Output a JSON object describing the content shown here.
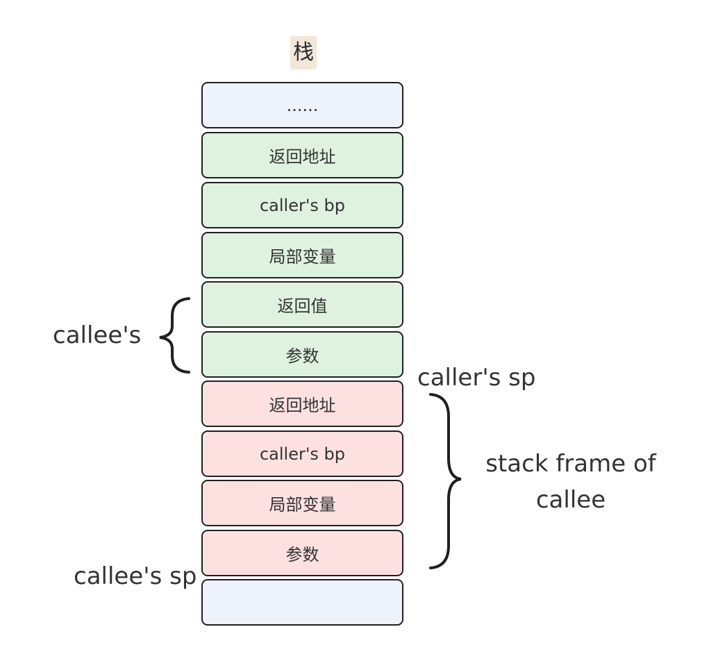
{
  "title": "栈",
  "cells": [
    {
      "text": "......",
      "fill": "neutral"
    },
    {
      "text": "返回地址",
      "fill": "green"
    },
    {
      "text": "caller's bp",
      "fill": "green"
    },
    {
      "text": "局部变量",
      "fill": "green"
    },
    {
      "text": "返回值",
      "fill": "green"
    },
    {
      "text": "参数",
      "fill": "green"
    },
    {
      "text": "返回地址",
      "fill": "red"
    },
    {
      "text": "caller's bp",
      "fill": "red"
    },
    {
      "text": "局部变量",
      "fill": "red"
    },
    {
      "text": "参数",
      "fill": "red"
    },
    {
      "text": "",
      "fill": "neutral"
    }
  ],
  "annotations": {
    "callee_args": "callee's",
    "caller_sp": "caller's sp",
    "callee_frame_line1": "stack frame of",
    "callee_frame_line2": "callee",
    "callee_sp": "callee's sp"
  },
  "colors": {
    "neutral": "#eef2fb",
    "green": "#dff2e0",
    "red": "#fde1e1",
    "border": "#1f1f1f",
    "title_bg": "#f3e7da"
  }
}
